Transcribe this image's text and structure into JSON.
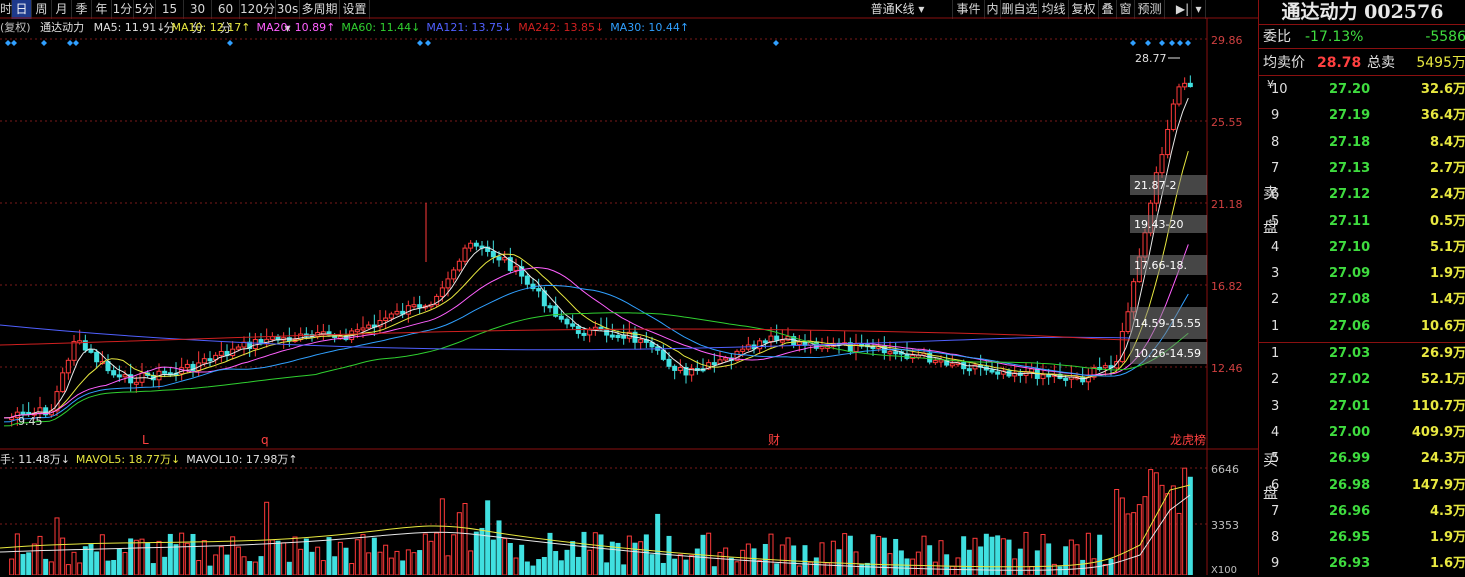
{
  "toolbar": {
    "periods": [
      "时",
      "日",
      "周",
      "月",
      "季",
      "年",
      "1分",
      "5分",
      "15分",
      "30分",
      "60分",
      "120分",
      "30s",
      "多周期",
      "设置"
    ],
    "active_period": "日",
    "right_items": [
      "普通K线",
      "事件",
      "内",
      "删自选",
      "均线",
      "复权",
      "叠",
      "窗",
      "预测"
    ]
  },
  "ma_legend": {
    "mode": "(复权)",
    "name": "通达动力",
    "items": [
      {
        "text": "MA5: 11.91↓",
        "color": "#e0e0e0"
      },
      {
        "text": "MA10: 12.17↑",
        "color": "#e8e840"
      },
      {
        "text": "MA20: 10.89↑",
        "color": "#ff60ff"
      },
      {
        "text": "MA60: 11.44↓",
        "color": "#30d030"
      },
      {
        "text": "MA121: 13.75↓",
        "color": "#5060ff"
      },
      {
        "text": "MA242: 13.85↓",
        "color": "#d02020"
      },
      {
        "text": "MA30: 10.44↑",
        "color": "#30a0ff"
      }
    ]
  },
  "price_axis": {
    "labels": [
      "29.86",
      "25.55",
      "21.18",
      "16.82",
      "12.46"
    ]
  },
  "price_annotations": {
    "high": "28.77",
    "low": "9.45"
  },
  "event_markers": [
    "L",
    "q",
    "财",
    "龙虎榜"
  ],
  "chip_zones": [
    "21.87-2",
    "19.43-20",
    "17.66-18.",
    "14.59-15.55",
    "10.26-14.59"
  ],
  "vol_legend": {
    "items": [
      {
        "text": "手: 11.48万↓",
        "color": "#e0e0e0"
      },
      {
        "text": "MAVOL5: 18.77万↓",
        "color": "#e8e840"
      },
      {
        "text": "MAVOL10: 17.98万↑",
        "color": "#e0e0e0"
      }
    ]
  },
  "vol_axis": {
    "labels": [
      "6646",
      "3353",
      "X100"
    ]
  },
  "stock": {
    "title": "通达动力 002576"
  },
  "quote": {
    "weibi_label": "委比",
    "weibi_value": "-17.13%",
    "weicha_value": "-5586",
    "avg_label": "均卖价",
    "avg_value": "28.78",
    "total_label": "总卖",
    "total_value": "5495万",
    "unit": "¥"
  },
  "orderbook": {
    "sell_label_1": "卖",
    "sell_label_2": "盘",
    "buy_label_1": "买",
    "buy_label_2": "盘",
    "sells": [
      {
        "idx": "10",
        "price": "27.20",
        "vol": "32.6万"
      },
      {
        "idx": "9",
        "price": "27.19",
        "vol": "36.4万"
      },
      {
        "idx": "8",
        "price": "27.18",
        "vol": "8.4万"
      },
      {
        "idx": "7",
        "price": "27.13",
        "vol": "2.7万"
      },
      {
        "idx": "6",
        "price": "27.12",
        "vol": "2.4万"
      },
      {
        "idx": "5",
        "price": "27.11",
        "vol": "0.5万"
      },
      {
        "idx": "4",
        "price": "27.10",
        "vol": "5.1万"
      },
      {
        "idx": "3",
        "price": "27.09",
        "vol": "1.9万"
      },
      {
        "idx": "2",
        "price": "27.08",
        "vol": "1.4万"
      },
      {
        "idx": "1",
        "price": "27.06",
        "vol": "10.6万"
      }
    ],
    "buys": [
      {
        "idx": "1",
        "price": "27.03",
        "vol": "26.9万"
      },
      {
        "idx": "2",
        "price": "27.02",
        "vol": "52.1万"
      },
      {
        "idx": "3",
        "price": "27.01",
        "vol": "110.7万"
      },
      {
        "idx": "4",
        "price": "27.00",
        "vol": "409.9万"
      },
      {
        "idx": "5",
        "price": "26.99",
        "vol": "24.3万"
      },
      {
        "idx": "6",
        "price": "26.98",
        "vol": "147.9万"
      },
      {
        "idx": "7",
        "price": "26.96",
        "vol": "4.3万"
      },
      {
        "idx": "8",
        "price": "26.95",
        "vol": "1.9万"
      },
      {
        "idx": "9",
        "price": "26.93",
        "vol": "1.6万"
      }
    ]
  }
}
